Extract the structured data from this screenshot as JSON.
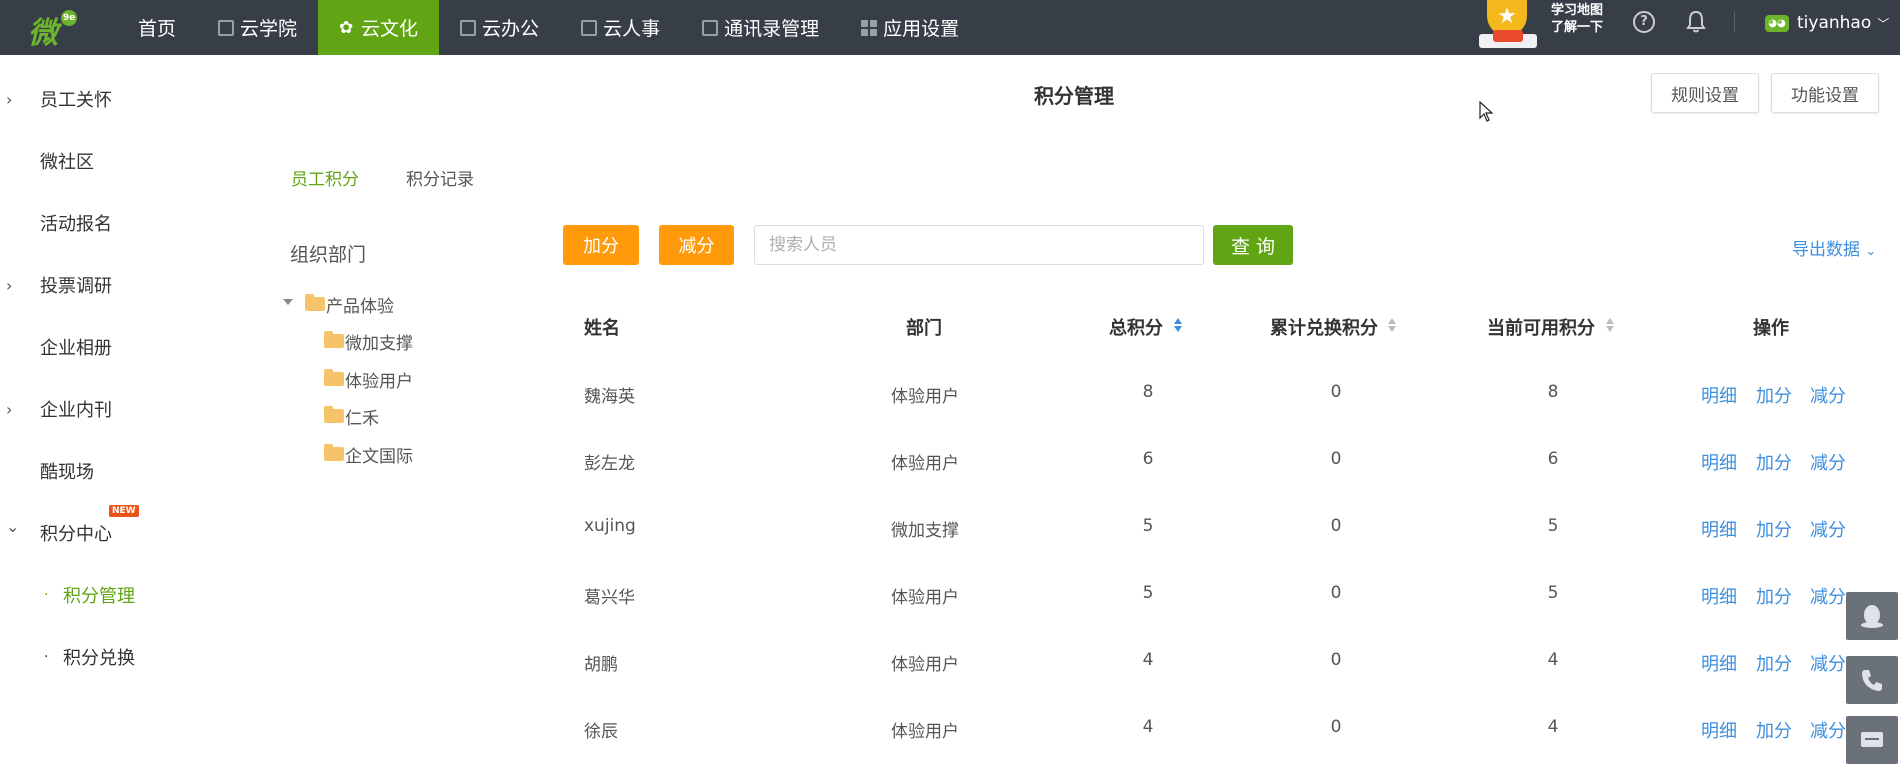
{
  "app": {
    "logo_text": "微",
    "logo_badge": "9e"
  },
  "nav": {
    "items": [
      {
        "label": "首页"
      },
      {
        "label": "云学院"
      },
      {
        "label": "云文化"
      },
      {
        "label": "云办公"
      },
      {
        "label": "云人事"
      },
      {
        "label": "通讯录管理"
      },
      {
        "label": "应用设置"
      }
    ],
    "active": "云文化",
    "promo_line1": "学习地图",
    "promo_line2": "了解一下",
    "username": "tiyanhao",
    "help_label": "?"
  },
  "sidebar": {
    "items": [
      {
        "label": "员工关怀",
        "arrow": "›"
      },
      {
        "label": "微社区"
      },
      {
        "label": "活动报名"
      },
      {
        "label": "投票调研",
        "arrow": "›"
      },
      {
        "label": "企业相册"
      },
      {
        "label": "企业内刊",
        "arrow": "›"
      },
      {
        "label": "酷现场"
      },
      {
        "label": "积分中心",
        "arrow": "⌄",
        "badge": "NEW"
      }
    ],
    "sub_items": [
      {
        "label": "积分管理",
        "bullet": "·"
      },
      {
        "label": "积分兑换",
        "bullet": "·"
      }
    ]
  },
  "header": {
    "title": "积分管理",
    "rule_settings": "规则设置",
    "function_settings": "功能设置"
  },
  "tabs": [
    {
      "label": "员工积分",
      "active": true
    },
    {
      "label": "积分记录",
      "active": false
    }
  ],
  "tree": {
    "title": "组织部门",
    "root": "产品体验",
    "children": [
      "微加支撑",
      "体验用户",
      "仁禾",
      "企文国际"
    ]
  },
  "toolbar": {
    "add_points": "加分",
    "deduct_points": "减分",
    "search_placeholder": "搜索人员",
    "query": "查 询",
    "export": "导出数据",
    "export_chevron": "⌄"
  },
  "table": {
    "headers": {
      "name": "姓名",
      "dept": "部门",
      "total": "总积分",
      "redeemed": "累计兑换积分",
      "available": "当前可用积分",
      "actions": "操作"
    },
    "actions": {
      "detail": "明细",
      "add": "加分",
      "deduct": "减分"
    },
    "rows": [
      {
        "name": "魏海英",
        "dept": "体验用户",
        "total": "8",
        "redeemed": "0",
        "available": "8"
      },
      {
        "name": "彭左龙",
        "dept": "体验用户",
        "total": "6",
        "redeemed": "0",
        "available": "6"
      },
      {
        "name": "xujing",
        "dept": "微加支撑",
        "total": "5",
        "redeemed": "0",
        "available": "5"
      },
      {
        "name": "葛兴华",
        "dept": "体验用户",
        "total": "5",
        "redeemed": "0",
        "available": "5"
      },
      {
        "name": "胡鹏",
        "dept": "体验用户",
        "total": "4",
        "redeemed": "0",
        "available": "4"
      },
      {
        "name": "徐辰",
        "dept": "体验用户",
        "total": "4",
        "redeemed": "0",
        "available": "4"
      }
    ]
  },
  "colors": {
    "topbar": "#383e48",
    "accent_green": "#61a514",
    "orange": "#ff9a0b",
    "link_blue": "#3d8fe0"
  }
}
